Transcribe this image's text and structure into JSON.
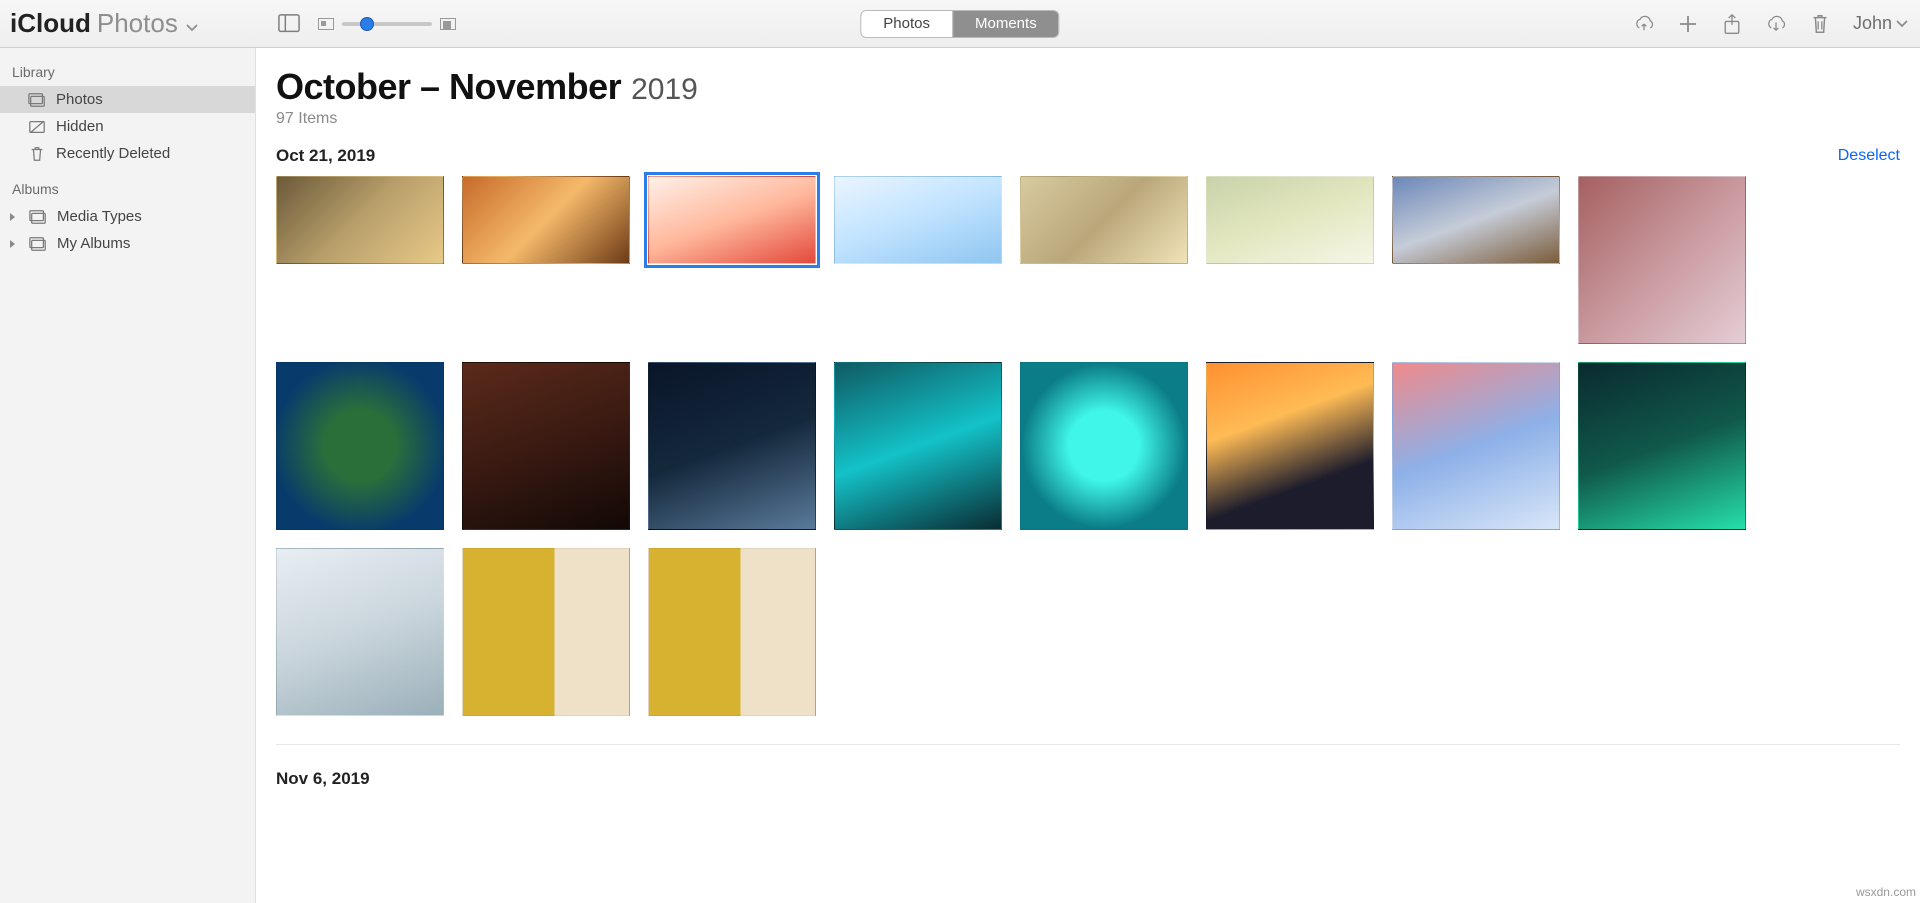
{
  "brand": {
    "primary": "iCloud",
    "secondary": "Photos"
  },
  "tabs": {
    "photos": "Photos",
    "moments": "Moments"
  },
  "user": {
    "name": "John"
  },
  "sidebar": {
    "library_header": "Library",
    "albums_header": "Albums",
    "items": [
      {
        "label": "Photos"
      },
      {
        "label": "Hidden"
      },
      {
        "label": "Recently Deleted"
      }
    ],
    "albums": [
      {
        "label": "Media Types"
      },
      {
        "label": "My Albums"
      }
    ]
  },
  "main": {
    "title_range": "October – November",
    "title_year": "2019",
    "subtitle": "97 Items",
    "deselect": "Deselect",
    "sections": [
      {
        "date": "Oct 21, 2019"
      },
      {
        "date": "Nov 6, 2019"
      }
    ]
  },
  "icons": {
    "sidebar_toggle": "sidebar-toggle-icon",
    "cloud_up": "cloud-upload-icon",
    "plus": "plus-icon",
    "share": "share-icon",
    "cloud_down": "cloud-download-icon",
    "trash": "trash-icon",
    "chevron": "chevron-down-icon"
  },
  "attribution": "wsxdn.com"
}
